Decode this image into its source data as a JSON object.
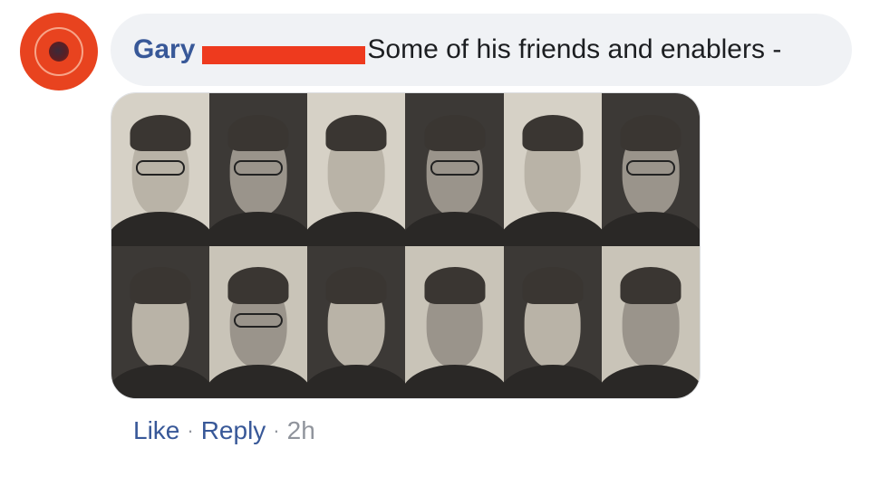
{
  "comment": {
    "author": "Gary",
    "text": "Some of his friends and enablers -"
  },
  "photo": {
    "rows": 2,
    "columns": 6,
    "faces": 12
  },
  "actions": {
    "like_label": "Like",
    "reply_label": "Reply",
    "separator": "·",
    "timestamp": "2h"
  },
  "colors": {
    "link": "#385898",
    "bubble": "#f0f2f5",
    "avatar": "#e8431f",
    "redaction": "#ee3a1e",
    "meta": "#90949c"
  }
}
